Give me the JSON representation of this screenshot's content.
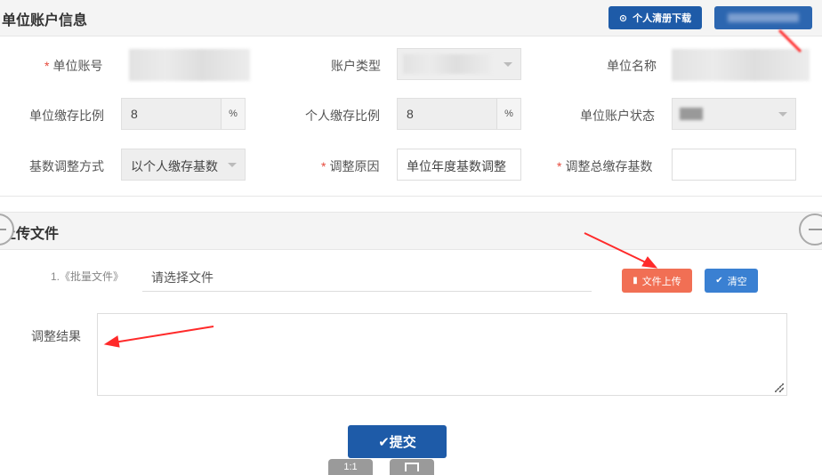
{
  "section1": {
    "title": "单位账户信息",
    "download_button": "个人清册下载"
  },
  "form": {
    "unit_account_label": "单位账号",
    "account_type_label": "账户类型",
    "unit_name_label": "单位名称",
    "unit_ratio_label": "单位缴存比例",
    "unit_ratio_value": "8",
    "personal_ratio_label": "个人缴存比例",
    "personal_ratio_value": "8",
    "unit_status_label": "单位账户状态",
    "percent_suffix": "%",
    "adjust_method_label": "基数调整方式",
    "adjust_method_value": "以个人缴存基数",
    "adjust_reason_label": "调整原因",
    "adjust_reason_value": "单位年度基数调整",
    "total_base_label": "调整总缴存基数",
    "total_base_value": "",
    "required_mark": "*"
  },
  "section2": {
    "title": "上传文件",
    "file_item_label": "1.《批量文件》",
    "file_placeholder": "请选择文件",
    "upload_button": "文件上传",
    "clear_button": "清空",
    "result_label": "调整结果",
    "submit_button": "✔提交"
  },
  "viewer": {
    "zoom_label": "1:1",
    "fit_icon": "fit-screen-icon"
  },
  "colors": {
    "primary": "#1e5ba8",
    "upload": "#f16f54",
    "clear": "#3a80d2",
    "required": "#e64a3c",
    "annotation_arrow": "#ff2a2a"
  }
}
